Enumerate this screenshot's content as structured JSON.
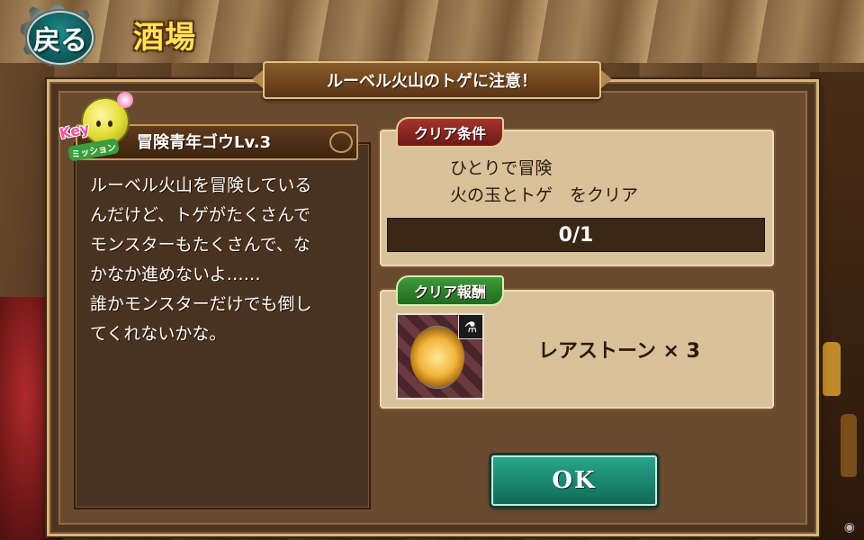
{
  "header": {
    "back_label": "戻る",
    "screen_title": "酒場"
  },
  "dialog": {
    "title": "ルーベル火山のトゲに注意！"
  },
  "npc": {
    "badge_label": "Key",
    "badge_sub": "ミッション",
    "name": "冒険青年ゴウLv.3",
    "message_lines": [
      "ルーベル火山を冒険している",
      "んだけど、トゲがたくさんで",
      "モンスターもたくさんで、な",
      "かなか進めないよ……",
      "誰かモンスターだけでも倒し",
      "てくれないかな。"
    ]
  },
  "condition": {
    "tag": "クリア条件",
    "line1": "ひとりで冒険",
    "line2": "火の玉とトゲ　をクリア",
    "progress_text": "0/1",
    "progress_fraction": 0
  },
  "reward": {
    "tag": "クリア報酬",
    "item_text": "レアストーン × 3",
    "icon": "rare-stone-icon"
  },
  "buttons": {
    "ok_label": "OK"
  },
  "colors": {
    "title_gold": "#ffe35a",
    "ok_teal": "#2aa58a",
    "condition_tag": "#a3342c",
    "reward_tag": "#3e9a3a"
  }
}
